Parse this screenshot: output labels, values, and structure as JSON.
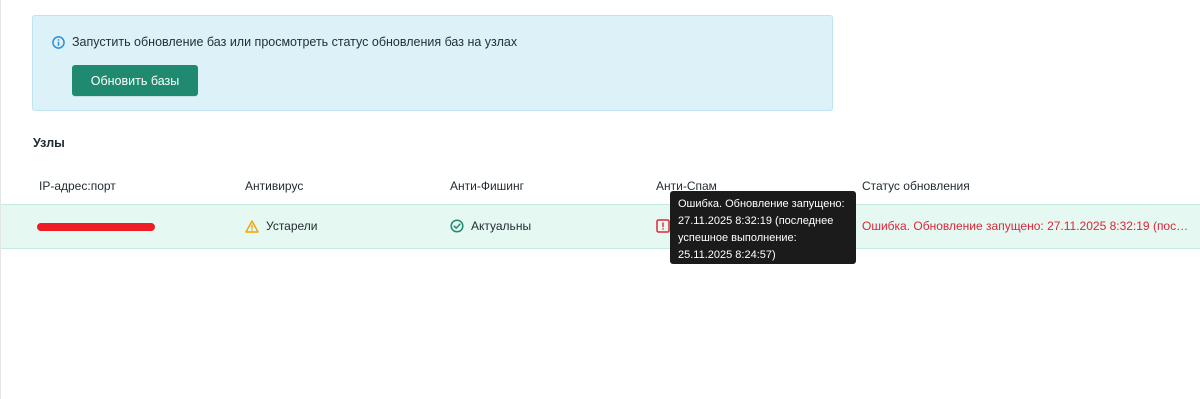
{
  "info_panel": {
    "icon": "info-icon",
    "message": "Запустить обновление баз или просмотреть статус обновления баз на узлах",
    "button_label": "Обновить базы"
  },
  "nodes_section": {
    "title": "Узлы",
    "columns": [
      "IP-адрес:порт",
      "Антивирус",
      "Анти-Фишинг",
      "Анти-Спам",
      "Статус обновления"
    ],
    "rows": [
      {
        "ip_port": "",
        "antivirus": {
          "icon": "warning-icon",
          "status": "Устарели"
        },
        "antiphishing": {
          "icon": "check-circle-icon",
          "status": "Актуальны"
        },
        "antispam": {
          "icon": "error-square-icon",
          "status": ""
        },
        "update_status": "Ошибка. Обновление запущено: 27.11.2025 8:32:19 (послед..."
      }
    ]
  },
  "tooltip": {
    "lines": [
      "Ошибка. Обновление запущено:",
      "27.11.2025 8:32:19 (последнее",
      "успешное выполнение:",
      "25.11.2025 8:24:57)"
    ]
  },
  "colors": {
    "accent": "#1f8a70",
    "info_bg": "#dcf1f8",
    "row_bg": "#e6f8f2",
    "error": "#d8283a",
    "warning": "#f0a500",
    "redaction": "#ee1c24"
  }
}
